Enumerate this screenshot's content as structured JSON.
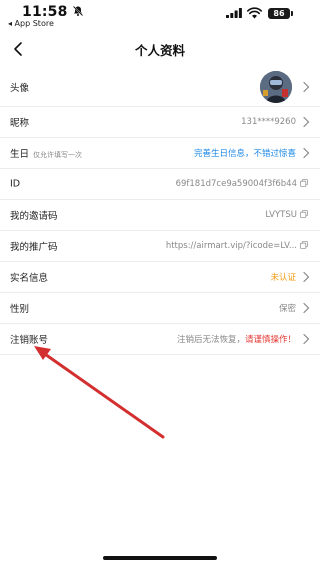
{
  "status_bar": {
    "time": "11:58",
    "back_app": "◂ App Store",
    "battery": "86"
  },
  "nav": {
    "title": "个人资料"
  },
  "rows": [
    {
      "label": "头像",
      "type": "avatar"
    },
    {
      "label": "昵称",
      "value": "131****9260"
    },
    {
      "label": "生日",
      "hint": "仅允许填写一次",
      "value": "完善生日信息，不错过惊喜"
    },
    {
      "label": "ID",
      "value": "69f181d7ce9a59004f3f6b44"
    },
    {
      "label": "我的邀请码",
      "value": "LVYTSU"
    },
    {
      "label": "我的推广码",
      "value": "https://airmart.vip/?icode=LV..."
    },
    {
      "label": "实名信息",
      "value": "未认证"
    },
    {
      "label": "性别",
      "value": "保密"
    },
    {
      "label": "注销账号",
      "value": "注销后无法恢复，",
      "warning": "请谨慎操作！"
    }
  ],
  "colors": {
    "link_blue": "#1e88e5",
    "unverified_orange": "#f39c12",
    "warning_red": "#e53935",
    "annotation_arrow": "#d32f2f"
  }
}
